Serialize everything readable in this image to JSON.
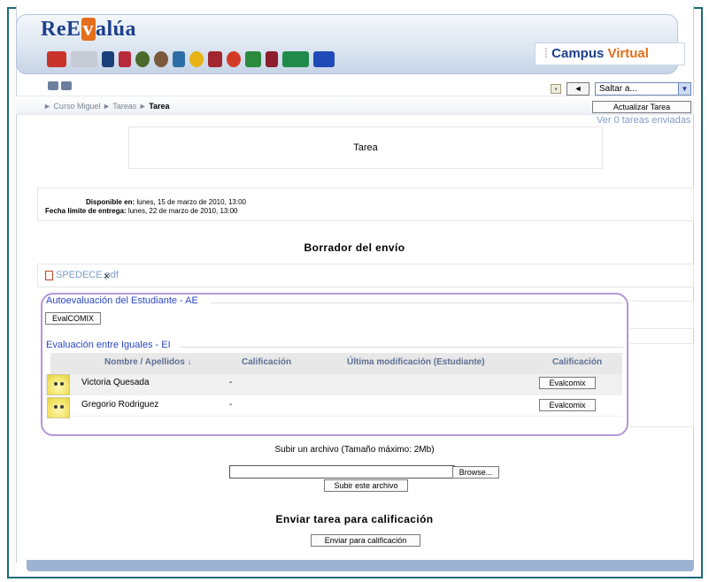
{
  "header": {
    "logo_pre": "ReE",
    "logo_mid": "v",
    "logo_post": "alúa",
    "campus_virtual_1": "Campus",
    "campus_virtual_2": "Virtual",
    "sponsor_logos": [
      "UCA",
      "ULL",
      "UNED",
      "univ",
      "univ",
      "univ",
      "univ",
      "univ",
      "univ",
      "univ",
      "univ",
      "univ",
      "univ",
      "junta",
      "EU"
    ]
  },
  "jump": {
    "prev_label": "◄",
    "select_value": "Saltar a..."
  },
  "breadcrumb": {
    "items": [
      "Curso Miguel",
      "Tareas"
    ],
    "current": "Tarea",
    "separator": "►"
  },
  "update_button": "Actualizar Tarea",
  "ver_link": "Ver 0 tareas enviadas",
  "tarea_box_text": "Tarea",
  "dates": {
    "available_label": "Disponible en:",
    "available_value": "lunes, 15 de marzo de 2010, 13:00",
    "due_label": "Fecha límite de entrega:",
    "due_value": "lunes, 22 de marzo de 2010, 13:00"
  },
  "draft_heading": "Borrador del envío",
  "file": {
    "name": "SPEDECE.pdf",
    "delete": "×"
  },
  "self_eval": {
    "legend": "Autoevaluación del Estudiante - AE",
    "button": "EvalCOMIX"
  },
  "peer_eval": {
    "legend": "Evaluación entre Iguales - EI",
    "headers": [
      "Nombre / Apellidos ↓",
      "Calificación",
      "Última modificación (Estudiante)",
      "Calificación"
    ],
    "rows": [
      {
        "name": "Victoria Quesada",
        "grade": "-",
        "button": "Evalcomix"
      },
      {
        "name": "Gregorio Rodriguez",
        "grade": "-",
        "button": "Evalcomix"
      }
    ]
  },
  "upload": {
    "label": "Subir un archivo (Tamaño máximo: 2Mb)",
    "browse": "Browse...",
    "submit": "Subir este archivo"
  },
  "send": {
    "heading": "Enviar tarea para calificación",
    "button": "Enviar para calificación"
  },
  "colors": {
    "frame": "#19697a",
    "accent_orange": "#e46e1c",
    "brand_blue": "#1c3f8c",
    "link": "#7f9dc6",
    "legend_blue": "#2a47c4",
    "highlight_purple": "#b497d6"
  }
}
